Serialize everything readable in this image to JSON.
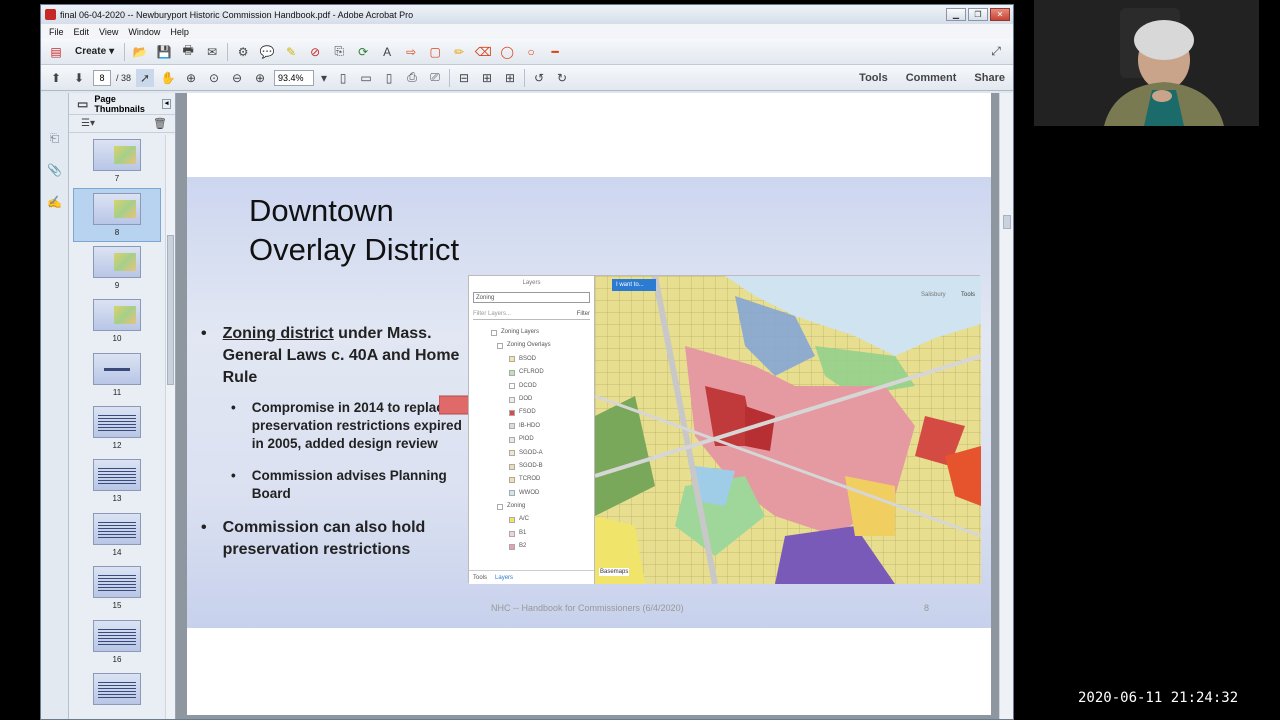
{
  "window": {
    "title": "final 06-04-2020 -- Newburyport Historic Commission Handbook.pdf - Adobe Acrobat Pro",
    "controls": [
      "minimize",
      "restore",
      "close"
    ]
  },
  "menu": [
    "File",
    "Edit",
    "View",
    "Window",
    "Help"
  ],
  "toolbar": {
    "create_label": "Create",
    "page_current": "8",
    "page_total": "/ 38",
    "zoom": "93.4%",
    "right_links": [
      "Tools",
      "Comment",
      "Share"
    ]
  },
  "thumbnails": {
    "header": "Page Thumbnails",
    "selected": 8,
    "pages": [
      {
        "num": "7",
        "kind": "map"
      },
      {
        "num": "8",
        "kind": "map"
      },
      {
        "num": "9",
        "kind": "map"
      },
      {
        "num": "10",
        "kind": "map"
      },
      {
        "num": "11",
        "kind": "title"
      },
      {
        "num": "12",
        "kind": "text"
      },
      {
        "num": "13",
        "kind": "text"
      },
      {
        "num": "14",
        "kind": "text"
      },
      {
        "num": "15",
        "kind": "text"
      },
      {
        "num": "16",
        "kind": "text"
      },
      {
        "num": "",
        "kind": "text"
      }
    ]
  },
  "slide": {
    "title_line1": "Downtown",
    "title_line2": "Overlay District",
    "bullet1_underlined": "Zoning district",
    "bullet1_rest": " under Mass. General Laws c. 40A and Home Rule",
    "sub1": "Compromise in 2014 to replace preservation restrictions expired in 2005, added design review",
    "sub2": "Commission advises Planning Board",
    "bullet2": "Commission can also hold preservation restrictions",
    "footer": "NHC -- Handbook for Commissioners (6/4/2020)",
    "page_number": "8"
  },
  "map_panel": {
    "header": "Layers",
    "select_value": "Zoning",
    "filter_placeholder": "Filter Layers...",
    "filter_button": "Filter",
    "group1": "Zoning Layers",
    "group2": "Zoning Overlays",
    "overlays": [
      "BSOD",
      "CFLROD",
      "DCOD",
      "DOD",
      "FSOD",
      "IB-HDO",
      "PIOD",
      "SGOD-A",
      "SGOD-B",
      "TCROD",
      "WWOD"
    ],
    "group3": "Zoning",
    "zones": [
      "A/C",
      "B1",
      "B2"
    ],
    "map_button": "I want to...",
    "map_label": "Salisbury",
    "tools_label": "Tools",
    "basemaps_label": "Basemaps",
    "tabs": [
      "Tools",
      "Layers"
    ]
  },
  "timestamp": "2020-06-11  21:24:32",
  "colors": {
    "accent_blue": "#2c7bd2",
    "arrow_red": "#e06a6a",
    "selection": "#b8d3ef"
  }
}
